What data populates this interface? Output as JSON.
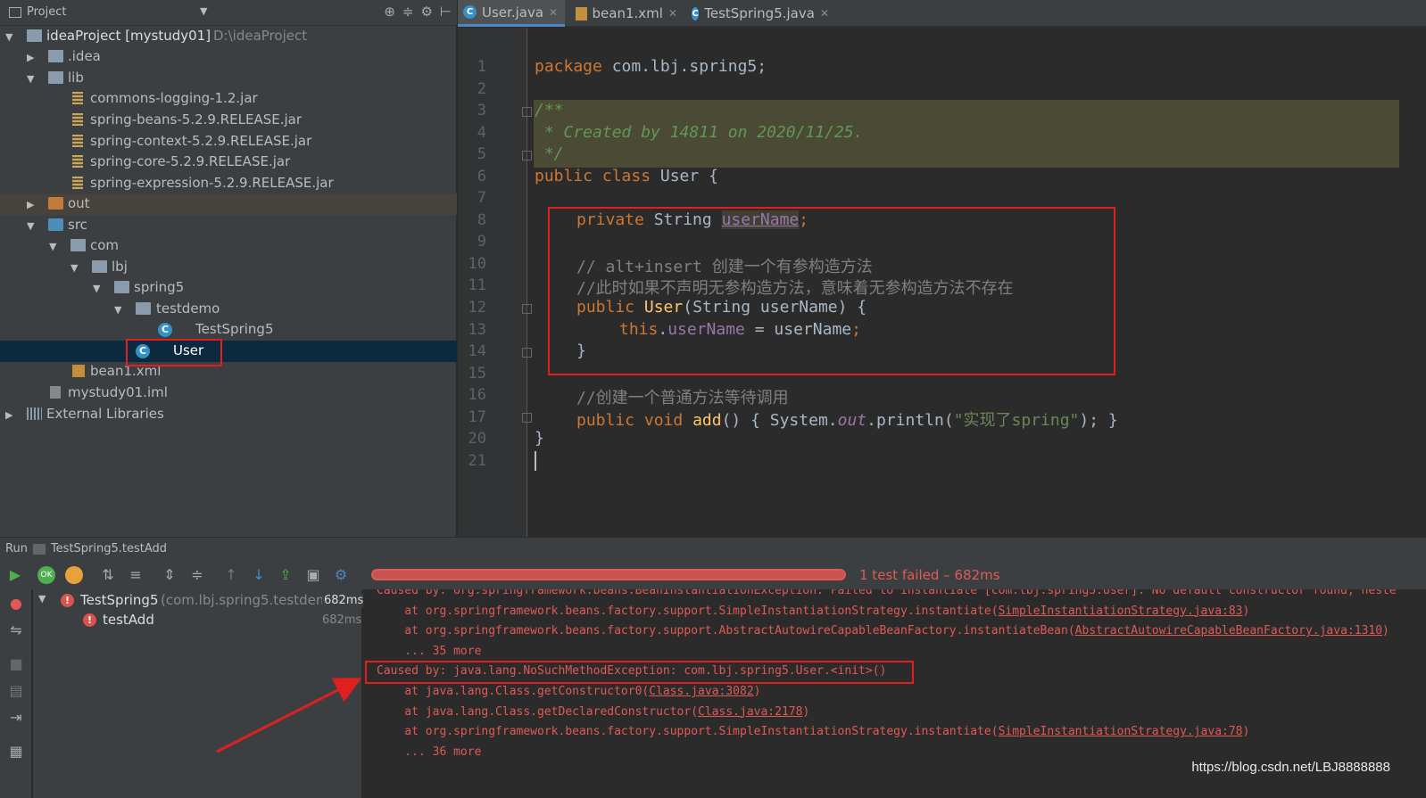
{
  "project": {
    "header_title": "Project",
    "root_name": "ideaProject [mystudy01]",
    "root_path": "D:\\ideaProject",
    "items": {
      "idea": ".idea",
      "lib": "lib",
      "jar1": "commons-logging-1.2.jar",
      "jar2": "spring-beans-5.2.9.RELEASE.jar",
      "jar3": "spring-context-5.2.9.RELEASE.jar",
      "jar4": "spring-core-5.2.9.RELEASE.jar",
      "jar5": "spring-expression-5.2.9.RELEASE.jar",
      "out": "out",
      "src": "src",
      "com": "com",
      "lbj": "lbj",
      "spring5": "spring5",
      "testdemo": "testdemo",
      "testspring5": "TestSpring5",
      "user": "User",
      "bean1": "bean1.xml",
      "iml": "mystudy01.iml",
      "extlibs": "External Libraries"
    }
  },
  "tabs": [
    {
      "label": "User.java",
      "icon": "class-icon"
    },
    {
      "label": "bean1.xml",
      "icon": "xml-icon"
    },
    {
      "label": "TestSpring5.java",
      "icon": "class-icon"
    }
  ],
  "editor": {
    "line_numbers": [
      "1",
      "2",
      "3",
      "4",
      "5",
      "6",
      "7",
      "8",
      "9",
      "10",
      "11",
      "12",
      "13",
      "14",
      "15",
      "16",
      "17",
      "20",
      "21"
    ],
    "l1_kw": "package",
    "l1_rest": " com.lbj.spring5;",
    "l3": "/**",
    "l4": " * Created by 14811 on 2020/11/25.",
    "l5": " */",
    "l6_kw": "public class",
    "l6_rest": " User {",
    "l8_kw": "private",
    "l8_type": " String ",
    "l8_field": "userName",
    "l8_semi": ";",
    "l10": "// alt+insert 创建一个有参构造方法",
    "l11": "//此时如果不声明无参构造方法，意味着无参构造方法不存在",
    "l12_kw": "public",
    "l12_fn": "User",
    "l12_rest": "(String userName) {",
    "l13_kw": "this",
    "l13_dot": ".",
    "l13_field": "userName",
    "l13_rest": " = userName",
    "l13_semi": ";",
    "l14": "}",
    "l16": "//创建一个普通方法等待调用",
    "l17_kw": "public void",
    "l17_fn": "add",
    "l17_a": "() { System.",
    "l17_out": "out",
    "l17_b": ".println(",
    "l17_str": "\"实现了spring\"",
    "l17_c": "); }",
    "l20": "}"
  },
  "run": {
    "label": "Run",
    "config": "TestSpring5.testAdd",
    "status": "1 test failed – 682ms",
    "progress_fraction": 1.0,
    "tests": [
      {
        "name": "TestSpring5",
        "detail": "(com.lbj.spring5.testdem",
        "time": "682ms"
      },
      {
        "name": "testAdd",
        "detail": "",
        "time": "682ms"
      }
    ]
  },
  "console": {
    "lines": [
      "Caused by: org.springframework.beans.BeanInstantiationException: Failed to instantiate [com.lbj.spring5.User]: No default constructor found; neste",
      "    at org.springframework.beans.factory.support.SimpleInstantiationStrategy.instantiate(",
      "    at org.springframework.beans.factory.support.AbstractAutowireCapableBeanFactory.instantiateBean(",
      "    ... 35 more",
      "Caused by: java.lang.NoSuchMethodException: com.lbj.spring5.User.<init>()",
      "    at java.lang.Class.getConstructor0(",
      "    at java.lang.Class.getDeclaredConstructor(",
      "    at org.springframework.beans.factory.support.SimpleInstantiationStrategy.instantiate(",
      "    ... 36 more"
    ],
    "links": [
      "",
      "SimpleInstantiationStrategy.java:83",
      "AbstractAutowireCapableBeanFactory.java:1310",
      "",
      "",
      "Class.java:3082",
      "Class.java:2178",
      "SimpleInstantiationStrategy.java:78",
      ""
    ]
  },
  "watermark": "https://blog.csdn.net/LBJ8888888",
  "colors": {
    "accent": "#4a88c7",
    "error": "#e05a55",
    "annotation_box": "#e02020",
    "selection": "#0d293e"
  }
}
